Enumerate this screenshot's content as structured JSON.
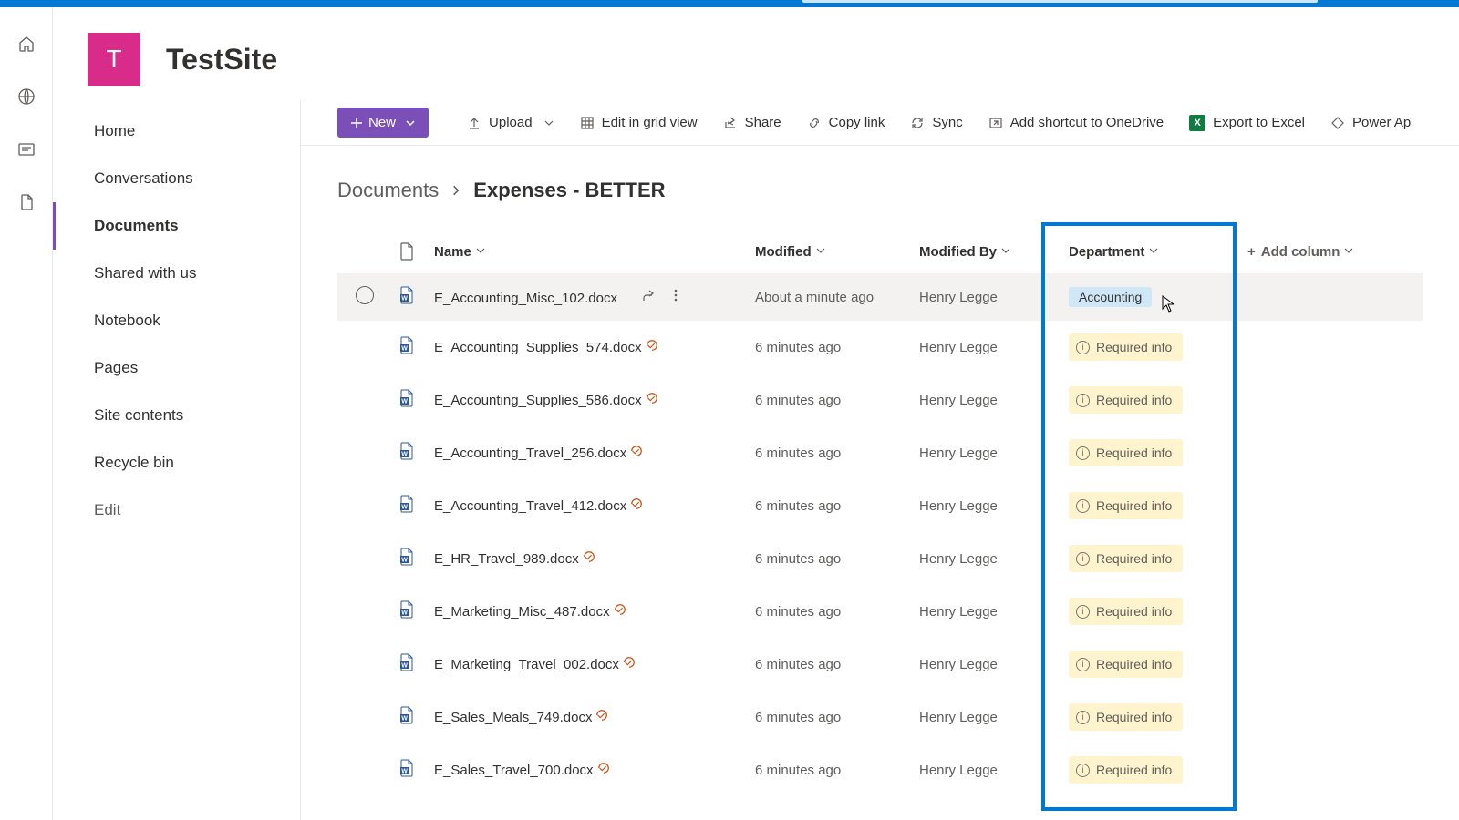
{
  "site": {
    "logo_letter": "T",
    "title": "TestSite"
  },
  "left_nav": {
    "items": [
      {
        "label": "Home",
        "active": false
      },
      {
        "label": "Conversations",
        "active": false
      },
      {
        "label": "Documents",
        "active": true
      },
      {
        "label": "Shared with us",
        "active": false
      },
      {
        "label": "Notebook",
        "active": false
      },
      {
        "label": "Pages",
        "active": false
      },
      {
        "label": "Site contents",
        "active": false
      },
      {
        "label": "Recycle bin",
        "active": false
      }
    ],
    "edit_label": "Edit"
  },
  "cmd_bar": {
    "new": "New",
    "upload": "Upload",
    "edit_grid": "Edit in grid view",
    "share": "Share",
    "copy_link": "Copy link",
    "sync": "Sync",
    "add_shortcut": "Add shortcut to OneDrive",
    "export_excel": "Export to Excel",
    "power_apps": "Power Ap"
  },
  "breadcrumb": {
    "root": "Documents",
    "current": "Expenses - BETTER"
  },
  "columns": {
    "name": "Name",
    "modified": "Modified",
    "modified_by": "Modified By",
    "department": "Department",
    "add_column": "Add column"
  },
  "required_info_label": "Required info",
  "rows": [
    {
      "name": "E_Accounting_Misc_102.docx",
      "modified": "About a minute ago",
      "modified_by": "Henry Legge",
      "dept_tag": "Accounting",
      "dept_required": false,
      "hover": true,
      "checked_out": false
    },
    {
      "name": "E_Accounting_Supplies_574.docx",
      "modified": "6 minutes ago",
      "modified_by": "Henry Legge",
      "dept_tag": null,
      "dept_required": true,
      "hover": false,
      "checked_out": true
    },
    {
      "name": "E_Accounting_Supplies_586.docx",
      "modified": "6 minutes ago",
      "modified_by": "Henry Legge",
      "dept_tag": null,
      "dept_required": true,
      "hover": false,
      "checked_out": true
    },
    {
      "name": "E_Accounting_Travel_256.docx",
      "modified": "6 minutes ago",
      "modified_by": "Henry Legge",
      "dept_tag": null,
      "dept_required": true,
      "hover": false,
      "checked_out": true
    },
    {
      "name": "E_Accounting_Travel_412.docx",
      "modified": "6 minutes ago",
      "modified_by": "Henry Legge",
      "dept_tag": null,
      "dept_required": true,
      "hover": false,
      "checked_out": true
    },
    {
      "name": "E_HR_Travel_989.docx",
      "modified": "6 minutes ago",
      "modified_by": "Henry Legge",
      "dept_tag": null,
      "dept_required": true,
      "hover": false,
      "checked_out": true
    },
    {
      "name": "E_Marketing_Misc_487.docx",
      "modified": "6 minutes ago",
      "modified_by": "Henry Legge",
      "dept_tag": null,
      "dept_required": true,
      "hover": false,
      "checked_out": true
    },
    {
      "name": "E_Marketing_Travel_002.docx",
      "modified": "6 minutes ago",
      "modified_by": "Henry Legge",
      "dept_tag": null,
      "dept_required": true,
      "hover": false,
      "checked_out": true
    },
    {
      "name": "E_Sales_Meals_749.docx",
      "modified": "6 minutes ago",
      "modified_by": "Henry Legge",
      "dept_tag": null,
      "dept_required": true,
      "hover": false,
      "checked_out": true
    },
    {
      "name": "E_Sales_Travel_700.docx",
      "modified": "6 minutes ago",
      "modified_by": "Henry Legge",
      "dept_tag": null,
      "dept_required": true,
      "hover": false,
      "checked_out": true
    }
  ],
  "colors": {
    "accent": "#7b4fb8",
    "brand": "#d82b8a",
    "highlight_border": "#0078d4"
  }
}
